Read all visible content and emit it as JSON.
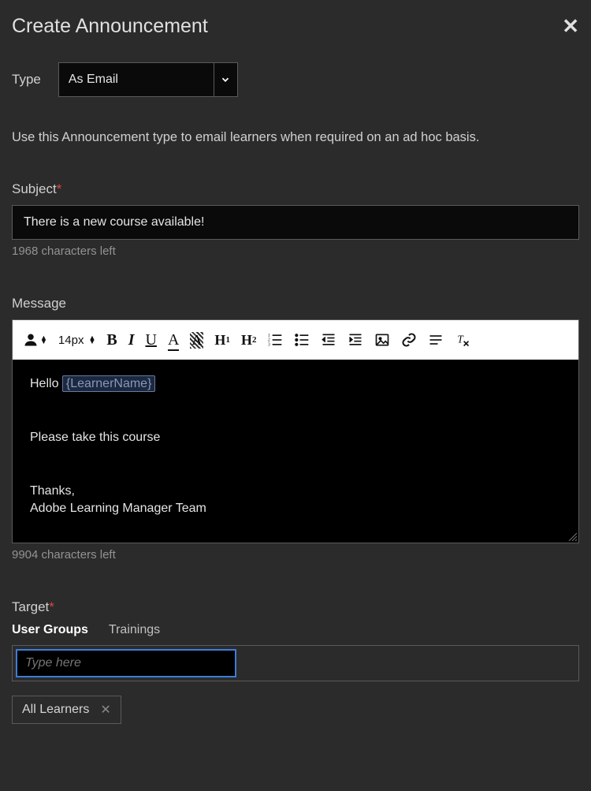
{
  "header": {
    "title": "Create Announcement"
  },
  "type": {
    "label": "Type",
    "selected": "As Email"
  },
  "description": "Use this Announcement type to email learners when required on an ad hoc basis.",
  "subject": {
    "label": "Subject",
    "value": "There is a new course available!",
    "hint": "1968 characters left"
  },
  "message": {
    "label": "Message",
    "toolbar": {
      "fontsize": "14px"
    },
    "body": {
      "line1_prefix": "Hello ",
      "line1_token": "{LearnerName}",
      "line2": "Please take this course",
      "line3": "Thanks,",
      "line4": "Adobe Learning Manager Team"
    },
    "hint": "9904 characters left"
  },
  "target": {
    "label": "Target",
    "tabs": {
      "user_groups": "User Groups",
      "trainings": "Trainings"
    },
    "input_placeholder": "Type here",
    "chips": {
      "all_learners": "All Learners"
    }
  }
}
